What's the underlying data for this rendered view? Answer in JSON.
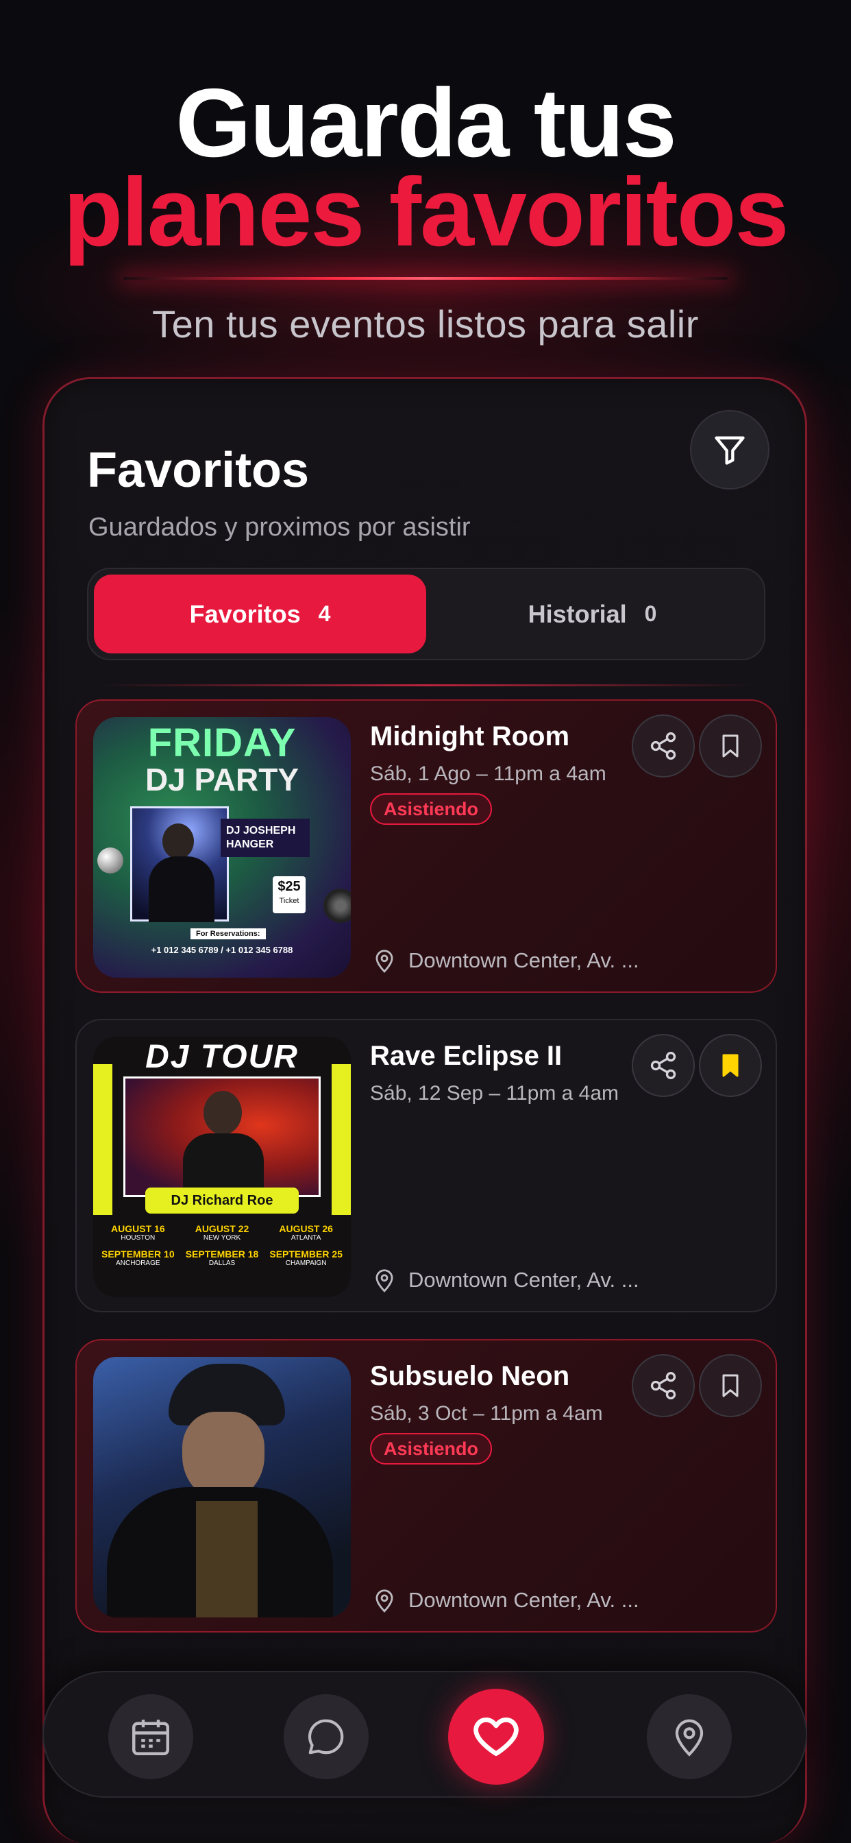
{
  "hero": {
    "line1": "Guarda tus",
    "line2": "planes favoritos",
    "tagline": "Ten tus eventos listos para salir"
  },
  "panel": {
    "title": "Favoritos",
    "subtitle": "Guardados y proximos por asistir",
    "filter_icon": "filter-icon"
  },
  "tabs": [
    {
      "label": "Favoritos",
      "count": "4",
      "active": true
    },
    {
      "label": "Historial",
      "count": "0",
      "active": false
    }
  ],
  "events": [
    {
      "title": "Midnight Room",
      "date": "Sáb, 1 Ago – 11pm a 4am",
      "badge": "Asistiendo",
      "location": "Downtown Center, Av. ...",
      "saved": false,
      "poster": {
        "line1": "FRIDAY",
        "line2": "DJ PARTY",
        "dj": "DJ JOSHEPH HANGER",
        "price": "$25",
        "price_note": "Ticket",
        "reservations": "For Reservations:",
        "phones": "+1 012 345 6789  /  +1 012 345 6788"
      }
    },
    {
      "title": "Rave Eclipse II",
      "date": "Sáb, 12 Sep – 11pm a 4am",
      "badge": "",
      "location": "Downtown Center, Av. ...",
      "saved": true,
      "poster": {
        "line1": "DJ TOUR",
        "dj": "DJ Richard Roe",
        "dates": [
          {
            "date": "AUGUST 16",
            "city": "HOUSTON"
          },
          {
            "date": "AUGUST 22",
            "city": "NEW YORK"
          },
          {
            "date": "AUGUST 26",
            "city": "ATLANTA"
          },
          {
            "date": "SEPTEMBER 10",
            "city": "ANCHORAGE"
          },
          {
            "date": "SEPTEMBER 18",
            "city": "DALLAS"
          },
          {
            "date": "SEPTEMBER 25",
            "city": "CHAMPAIGN"
          }
        ]
      }
    },
    {
      "title": "Subsuelo Neon",
      "date": "Sáb, 3 Oct – 11pm a 4am",
      "badge": "Asistiendo",
      "location": "Downtown Center, Av. ...",
      "saved": false
    }
  ],
  "nav": [
    {
      "icon": "calendar-icon",
      "active": false
    },
    {
      "icon": "chat-icon",
      "active": false
    },
    {
      "icon": "heart-icon",
      "active": true
    },
    {
      "icon": "location-pin-icon",
      "active": false
    }
  ],
  "colors": {
    "accent": "#e8193f",
    "headline_red": "#ec1a3d",
    "saved_yellow": "#ffd400",
    "background": "#0b0a0e"
  }
}
